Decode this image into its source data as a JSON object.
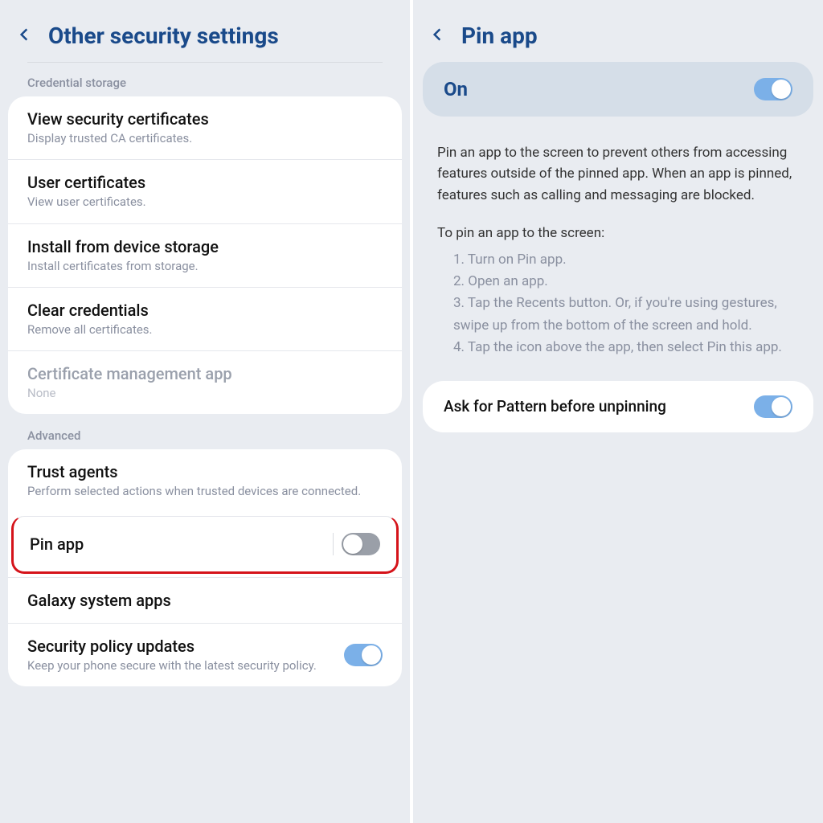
{
  "left": {
    "title": "Other security settings",
    "section1_label": "Credential storage",
    "section2_label": "Advanced",
    "items1": [
      {
        "title": "View security certificates",
        "sub": "Display trusted CA certificates."
      },
      {
        "title": "User certificates",
        "sub": "View user certificates."
      },
      {
        "title": "Install from device storage",
        "sub": "Install certificates from storage."
      },
      {
        "title": "Clear credentials",
        "sub": "Remove all certificates."
      },
      {
        "title": "Certificate management app",
        "sub": "None"
      }
    ],
    "items2": {
      "trust": {
        "title": "Trust agents",
        "sub": "Perform selected actions when trusted devices are connected."
      },
      "pin": {
        "title": "Pin app"
      },
      "galaxy": {
        "title": "Galaxy system apps"
      },
      "policy": {
        "title": "Security policy updates",
        "sub": "Keep your phone secure with the latest security policy."
      }
    }
  },
  "right": {
    "title": "Pin app",
    "on_label": "On",
    "description": "Pin an app to the screen to prevent others from accessing features outside of the pinned app. When an app is pinned, features such as calling and messaging are blocked.",
    "steps_intro": "To pin an app to the screen:",
    "steps": [
      "1. Turn on Pin app.",
      "2. Open an app.",
      "3. Tap the Recents button. Or, if you're using gestures, swipe up from the bottom of the screen and hold.",
      "4. Tap the icon above the app, then select Pin this app."
    ],
    "ask_label": "Ask for Pattern before unpinning"
  }
}
